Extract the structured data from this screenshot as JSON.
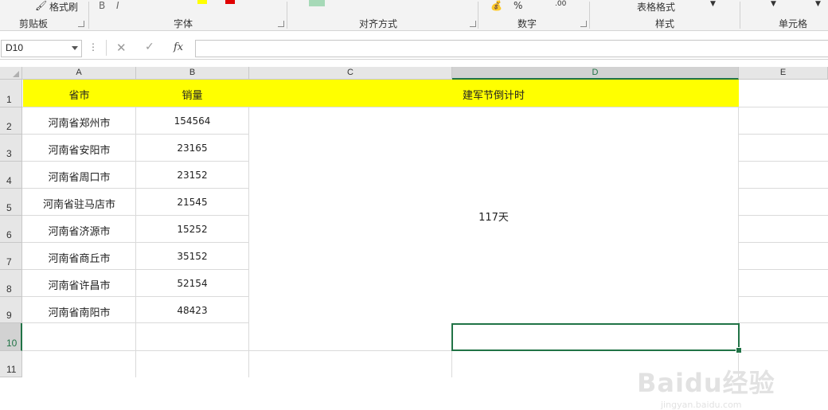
{
  "ribbon": {
    "format_painter": "格式刷",
    "groups": [
      "剪贴板",
      "字体",
      "对齐方式",
      "数字",
      "样式",
      "单元格"
    ],
    "table_format": "表格格式",
    "percent": "%",
    "decimal": ".00"
  },
  "formula_bar": {
    "name_box": "D10",
    "cancel": "✕",
    "enter": "✓",
    "fx": "fx",
    "formula": ""
  },
  "columns": [
    "A",
    "B",
    "C",
    "D",
    "E"
  ],
  "selected_column": "D",
  "rows": [
    "1",
    "2",
    "3",
    "4",
    "5",
    "6",
    "7",
    "8",
    "9",
    "10",
    "11"
  ],
  "selected_row": "10",
  "header": {
    "a1": "省市",
    "b1": "销量",
    "merged": "建军节倒计时"
  },
  "data_rows": [
    {
      "city": "河南省郑州市",
      "sales": "154564"
    },
    {
      "city": "河南省安阳市",
      "sales": "23165"
    },
    {
      "city": "河南省周口市",
      "sales": "23152"
    },
    {
      "city": "河南省驻马店市",
      "sales": "21545"
    },
    {
      "city": "河南省济源市",
      "sales": "15252"
    },
    {
      "city": "河南省商丘市",
      "sales": "35152"
    },
    {
      "city": "河南省许昌市",
      "sales": "52154"
    },
    {
      "city": "河南省南阳市",
      "sales": "48423"
    }
  ],
  "countdown": "117天",
  "watermark": {
    "big": "Baidu经验",
    "small": "jingyan.baidu.com"
  },
  "colors": {
    "highlight": "#ffff00",
    "selection": "#217346"
  }
}
